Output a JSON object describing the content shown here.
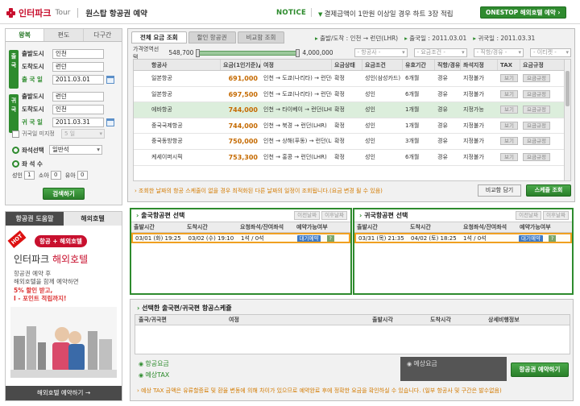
{
  "header": {
    "logo_name": "인터파크",
    "logo_tour": "Tour",
    "service": "원스탑 항공권 예약",
    "notice_label": "NOTICE",
    "notice_text": "결제금액이 1만원 이상일 경우 하트 3장 적립",
    "onestop_button": "ONESTOP 해외호텔 예약 ›"
  },
  "search": {
    "trip_tabs": [
      "왕복",
      "편도",
      "다구간"
    ],
    "depart_segment": "출국",
    "return_segment": "귀국",
    "depart": {
      "from_label": "출발도시",
      "from": "인천",
      "to_label": "도착도시",
      "to": "런던",
      "date_label": "출 국 일",
      "date": "2011.03.01"
    },
    "return": {
      "from_label": "출발도시",
      "from": "런던",
      "to_label": "도착도시",
      "to": "인천",
      "date_label": "귀 국 일",
      "date": "2011.03.31"
    },
    "unset_return_label": "귀국일 미지정",
    "unset_return_value": "5 일",
    "seat_label": "좌석선택",
    "seat_value": "일반석",
    "pax_label": "좌 석 수",
    "adult_label": "성인",
    "adult_count": "1",
    "child_label": "소아",
    "child_count": "0",
    "infant_label": "유아",
    "infant_count": "0",
    "search_button": "검색하기"
  },
  "promo": {
    "tab_active": "항공권 도움말",
    "tab_other": "해외호텔",
    "hot_badge": "HOT",
    "pill": "항공 + 해외호텔",
    "title_prefix": "인터파크",
    "title_highlight": "해외호텔",
    "desc_line1": "항공권 예약 후",
    "desc_line2": "해외호텔을 함께 예약하면",
    "highlight_line1": "5% 할인 받고,",
    "highlight_line2": "I - 포인트 적립까지!",
    "footer": "해외호텔 예약하기 →"
  },
  "main": {
    "tabs": [
      "전체 요금 조회",
      "할인 항공권",
      "비교함 조회"
    ],
    "route_label": "출발/도착 : 인천 → 런던(LHR)",
    "depart_date": "출국일 : 2011.03.01",
    "return_date": "귀국일 : 2011.03.31",
    "price_range_label": "가격영역선택",
    "price_min": "548,700",
    "price_max": "4,000,000",
    "filter_airline": "- 항공사 -",
    "filter_condition": "- 요금조건 -",
    "filter_direct": "- 직항/경유 -",
    "filter_ticket": "- 이티켓 -",
    "columns": [
      "항공사",
      "요금(1인기준)▲",
      "여정",
      "요금상태",
      "요금조건",
      "유효기간",
      "직항/경유",
      "좌석지정",
      "TAX",
      "요금규정"
    ],
    "rows": [
      {
        "airline": "일본항공",
        "price": "691,000",
        "route": "인천 → 도쿄(나리타) → 런던(LHR)",
        "status": "확정",
        "condition": "성인(삼성카드)",
        "validity": "6개월",
        "direct": "경유",
        "seat": "지정불가",
        "tax": "보기",
        "rule": "요금규정"
      },
      {
        "airline": "일본항공",
        "price": "697,500",
        "route": "인천 → 도쿄(나리타) → 런던(LHR)",
        "status": "확정",
        "condition": "성인",
        "validity": "6개월",
        "direct": "경유",
        "seat": "지정불가",
        "tax": "보기",
        "rule": "요금규정"
      },
      {
        "airline": "에바항공",
        "price": "744,000",
        "route": "인천 → 타이베이 → 런던(LHR)",
        "status": "확정",
        "condition": "성인",
        "validity": "1개월",
        "direct": "경유",
        "seat": "지정가능",
        "tax": "보기",
        "rule": "요금규정"
      },
      {
        "airline": "중국국제항공",
        "price": "744,000",
        "route": "인천 → 북경 → 런던(LHR)",
        "status": "확정",
        "condition": "성인",
        "validity": "1개월",
        "direct": "경유",
        "seat": "지정불가",
        "tax": "보기",
        "rule": "요금규정"
      },
      {
        "airline": "중국동방항공",
        "price": "750,000",
        "route": "인천 → 상해(푸동) → 런던(LHR)",
        "status": "확정",
        "condition": "성인",
        "validity": "3개월",
        "direct": "경유",
        "seat": "지정불가",
        "tax": "보기",
        "rule": "요금규정"
      },
      {
        "airline": "케세이퍼시픽",
        "price": "753,300",
        "route": "인천 → 홍콩 → 런던(LHR)",
        "status": "확정",
        "condition": "성인",
        "validity": "6개월",
        "direct": "경유",
        "seat": "지정불가",
        "tax": "보기",
        "rule": "요금규정"
      },
      {
        "airline": "",
        "price": "",
        "route": "",
        "status": "",
        "condition": "",
        "validity": "",
        "direct": "",
        "seat": "",
        "tax": "",
        "rule": ""
      }
    ],
    "note": "조회한 날짜의 항공 스케줄이 없을 경우 최적화된 다른 날짜의 일정이 조회됩니다.(요금 변경 될 수 있음)",
    "compare_button": "비교함 담기",
    "schedule_button": "스케줄 조회"
  },
  "outbound": {
    "title": "출국항공편 선택",
    "prev": "이전날짜",
    "next": "이후날짜",
    "columns": [
      "출발시간",
      "도착시간",
      "요청좌석/잔여좌석",
      "예약가능여부"
    ],
    "dep": "03/01 (화) 19:25",
    "arr": "03/02 (수) 19:10",
    "seats": "1석 / 0석",
    "status": "대기예약",
    "help": "?"
  },
  "inbound": {
    "title": "귀국항공편 선택",
    "prev": "이전날짜",
    "next": "이후날짜",
    "columns": [
      "출발시간",
      "도착시간",
      "요청좌석/잔여좌석",
      "예약가능여부"
    ],
    "dep": "03/31 (목) 21:35",
    "arr": "04/02 (토) 18:25",
    "seats": "1석 / 0석",
    "status": "대기예약",
    "help": "?"
  },
  "summary": {
    "title": "선택한 출국편/귀국편 항공스케쥴",
    "columns": [
      "출국/귀국편",
      "여정",
      "출발시각",
      "도착시각",
      "상세비행정보"
    ],
    "fare_label": "항공요금",
    "tax_label": "예상TAX",
    "expected_label": "예상요금",
    "reserve_button": "항공권 예약하기",
    "bottom_note": "예상 TAX 금액은 유류할증료 및 환율 변동에 의해 차이가 있으므로 예약완료 후에 정확한 요금을 확인하실 수 있습니다. (일부 항공사 및 구간은 발수없음)"
  },
  "colors": {
    "brand_red": "#c8102e",
    "accent_green": "#2e8b2e",
    "price_orange": "#c56a00",
    "highlight_row": "#dceedc"
  }
}
